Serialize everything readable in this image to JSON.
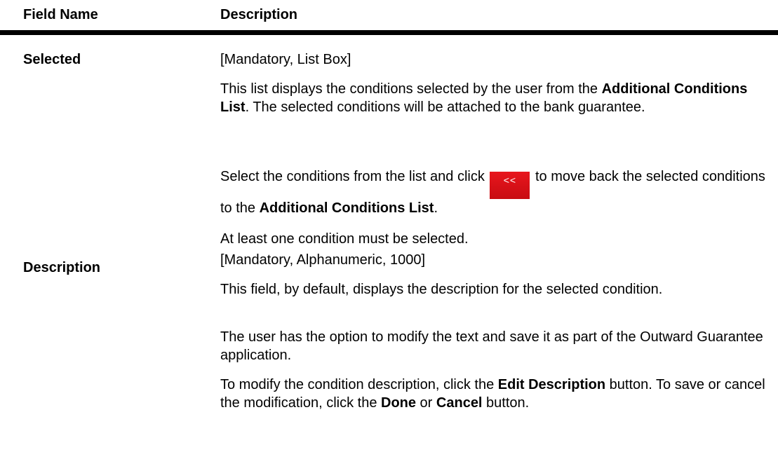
{
  "header": {
    "col1": "Field Name",
    "col2": "Description"
  },
  "rows": [
    {
      "field": "Selected",
      "p1": "[Mandatory, List Box]",
      "p2": {
        "a": "This list displays the conditions selected by the user from the ",
        "b": "Additional Conditions List",
        "c": ". The selected conditions will be attached to the bank guarantee."
      },
      "p3": {
        "a": "Select the conditions from the list and click ",
        "icon": "<<",
        "b": " to move back the selected conditions to the ",
        "c": "Additional Conditions List",
        "d": "."
      },
      "p4": " At least one condition must be selected."
    },
    {
      "field": "Description",
      "p1": "[Mandatory, Alphanumeric, 1000]",
      "p2": "This field, by default, displays the description for the selected condition.",
      "p3": "The user has the option to modify the text and save it as part of the Outward Guarantee application.",
      "p4": {
        "a": "To modify the condition description, click the ",
        "b": "Edit Description",
        "c": " button. To save or cancel the modification, click the ",
        "d": "Done",
        "e": " or ",
        "f": "Cancel",
        "g": " button."
      }
    }
  ],
  "colors": {
    "icon_bg": "#d8101a",
    "rule": "#000000"
  }
}
